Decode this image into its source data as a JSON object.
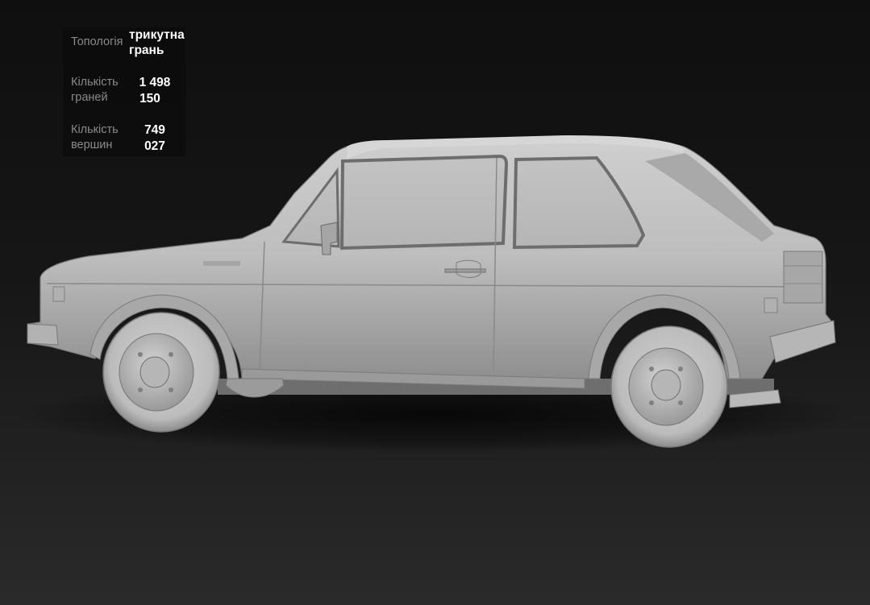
{
  "stats": {
    "topology_label": "Топологія",
    "topology_value_line1": "трикутна",
    "topology_value_line2": "грань",
    "faces_label_line1": "Кількість",
    "faces_label_line2": "граней",
    "faces_value_line1": "1 498",
    "faces_value_line2": "150",
    "vertices_label_line1": "Кількість",
    "vertices_label_line2": "вершин",
    "vertices_value_line1": "749",
    "vertices_value_line2": "027"
  },
  "colors": {
    "background_top": "#0f0f0f",
    "background_bottom": "#2a2a2a",
    "model_body": "#bdbdbd",
    "label": "#8a8a8a",
    "value": "#ffffff"
  },
  "icons": {
    "model": "car-3d-model"
  }
}
